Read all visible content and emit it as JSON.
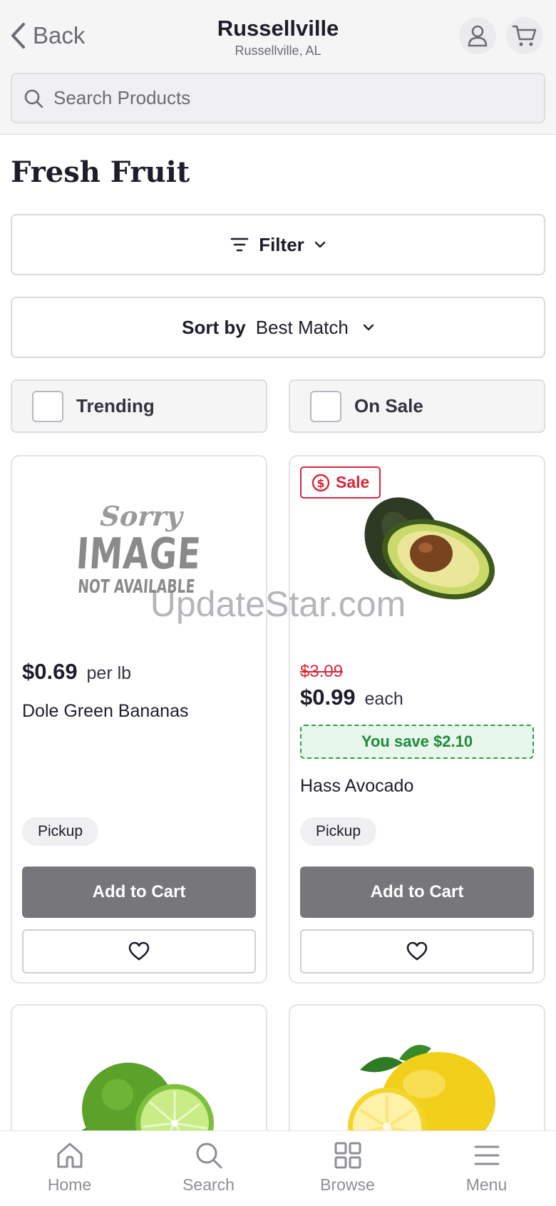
{
  "header": {
    "back_label": "Back",
    "store_name": "Russellville",
    "store_location": "Russellville, AL",
    "search_placeholder": "Search Products"
  },
  "page": {
    "title": "Fresh Fruit",
    "filter_label": "Filter",
    "sort_label": "Sort by",
    "sort_value": "Best Match",
    "chips": [
      "Trending",
      "On Sale"
    ]
  },
  "products": [
    {
      "image_placeholder": {
        "line1": "Sorry",
        "line2": "IMAGE",
        "line3": "NOT AVAILABLE"
      },
      "price": "$0.69",
      "unit": "per lb",
      "name": "Dole Green Bananas",
      "fulfillment": "Pickup",
      "add_label": "Add to Cart"
    },
    {
      "badge": "Sale",
      "old_price": "$3.09",
      "price": "$0.99",
      "unit": "each",
      "savings": "You save $2.10",
      "name": "Hass Avocado",
      "fulfillment": "Pickup",
      "add_label": "Add to Cart"
    }
  ],
  "watermark": "UpdateStar.com",
  "nav": [
    "Home",
    "Search",
    "Browse",
    "Menu"
  ],
  "colors": {
    "sale_red": "#d62839",
    "save_green": "#1f8a3c",
    "button_gray": "#77777b"
  }
}
